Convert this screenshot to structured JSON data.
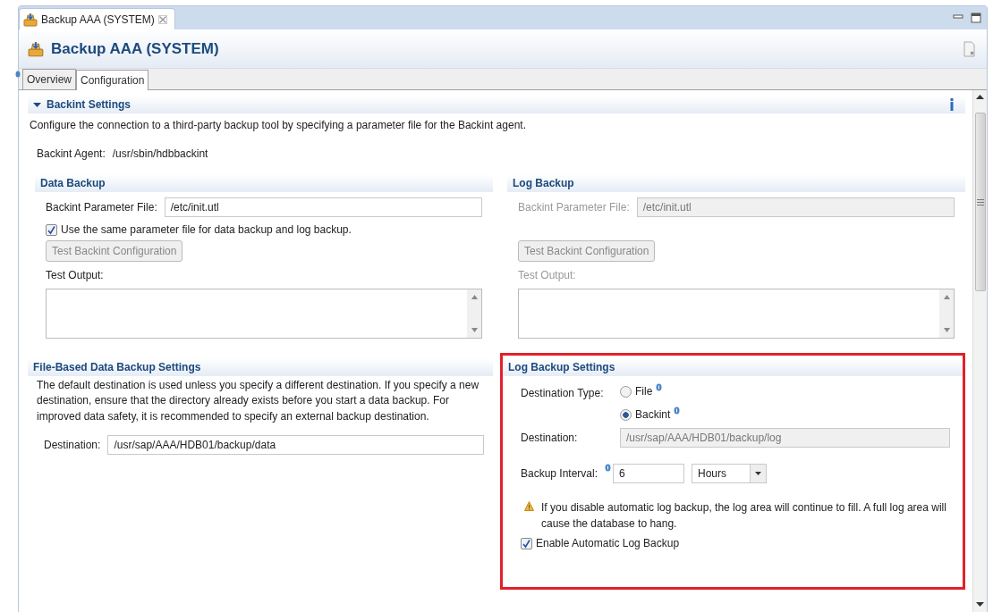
{
  "editor_tab": {
    "title": "Backup AAA (SYSTEM)",
    "selected": true
  },
  "header": {
    "title": "Backup AAA (SYSTEM)"
  },
  "page_tabs": [
    {
      "label": "Overview",
      "selected": false
    },
    {
      "label": "Configuration",
      "selected": true
    }
  ],
  "backint_settings": {
    "title": "Backint Settings",
    "expanded": true,
    "description": "Configure the connection to a third-party backup tool by specifying a parameter file for the Backint agent.",
    "agent_label": "Backint Agent:",
    "agent_value": "/usr/sbin/hdbbackint",
    "panels": [
      {
        "title": "Data Backup",
        "disabled": false,
        "param_label": "Backint Parameter File:",
        "param_value": "/etc/init.utl",
        "checkbox": {
          "label": "Use the same parameter file for data backup and log backup.",
          "checked": true
        },
        "test_button": {
          "label": "Test Backint Configuration",
          "disabled": true
        },
        "output_label": "Test Output:"
      },
      {
        "title": "Log Backup",
        "disabled": true,
        "param_label": "Backint Parameter File:",
        "param_value": "/etc/init.utl",
        "test_button": {
          "label": "Test Backint Configuration",
          "disabled": true
        },
        "output_label": "Test Output:"
      }
    ]
  },
  "file_based_settings": {
    "title": "File-Based Data Backup Settings",
    "description": "The default destination is used unless you specify a different destination. If you specify a new destination, ensure that the directory already exists before you start a data backup. For improved data safety, it is recommended to specify an external backup destination.",
    "destination_label": "Destination:",
    "destination_value": "/usr/sap/AAA/HDB01/backup/data"
  },
  "log_backup_settings": {
    "title": "Log Backup Settings",
    "highlighted": true,
    "destination_type_label": "Destination Type:",
    "destination_types": [
      {
        "label": "File",
        "selected": false
      },
      {
        "label": "Backint",
        "selected": true
      }
    ],
    "destination_label": "Destination:",
    "destination_value": "/usr/sap/AAA/HDB01/backup/log",
    "destination_disabled": true,
    "interval_label": "Backup Interval:",
    "interval_value": "6",
    "interval_unit": "Hours",
    "warning": "If you disable automatic log backup, the log area will continue to fill. A full log area will cause the database to hang.",
    "enable_checkbox": {
      "label": "Enable Automatic Log Backup",
      "checked": true
    }
  }
}
